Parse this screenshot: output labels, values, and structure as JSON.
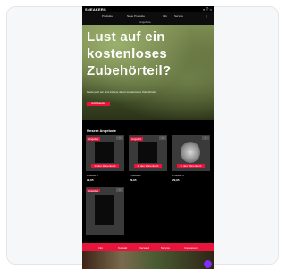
{
  "header": {
    "logo": "SNEAKERS",
    "icons": "⌕ ♡ ⌂"
  },
  "nav": {
    "items": [
      "Produkte",
      "Neue Produkte",
      "Info",
      "Service"
    ],
    "sub": "Angebote"
  },
  "hero": {
    "lines": [
      "Lust auf ein",
      "kostenloses",
      "Zubehörteil?"
    ],
    "subtitle": "Kaufe jetzt ein und sichere dir ein kostenloses Zubehörteil.",
    "button": "Jetzt kaufen"
  },
  "products": {
    "title": "Unsere Angebote",
    "items": [
      {
        "badge": "Angebot",
        "wish": "♡",
        "cart": "In den Warenkorb",
        "name": "Produkt 1",
        "price": "29,95"
      },
      {
        "badge": "Angebot",
        "wish": "♡",
        "cart": "In den Warenkorb",
        "name": "Produkt 2",
        "price": "29,95"
      },
      {
        "badge": "",
        "wish": "♡",
        "cart": "In den Warenkorb",
        "name": "Produkt 3",
        "price": "29,95"
      },
      {
        "badge": "Angebot",
        "wish": "♡",
        "cart": "",
        "name": "",
        "price": ""
      }
    ]
  },
  "footer": {
    "items": [
      "Info",
      "Kontakt",
      "Versand",
      "Service",
      "Impressum"
    ]
  }
}
